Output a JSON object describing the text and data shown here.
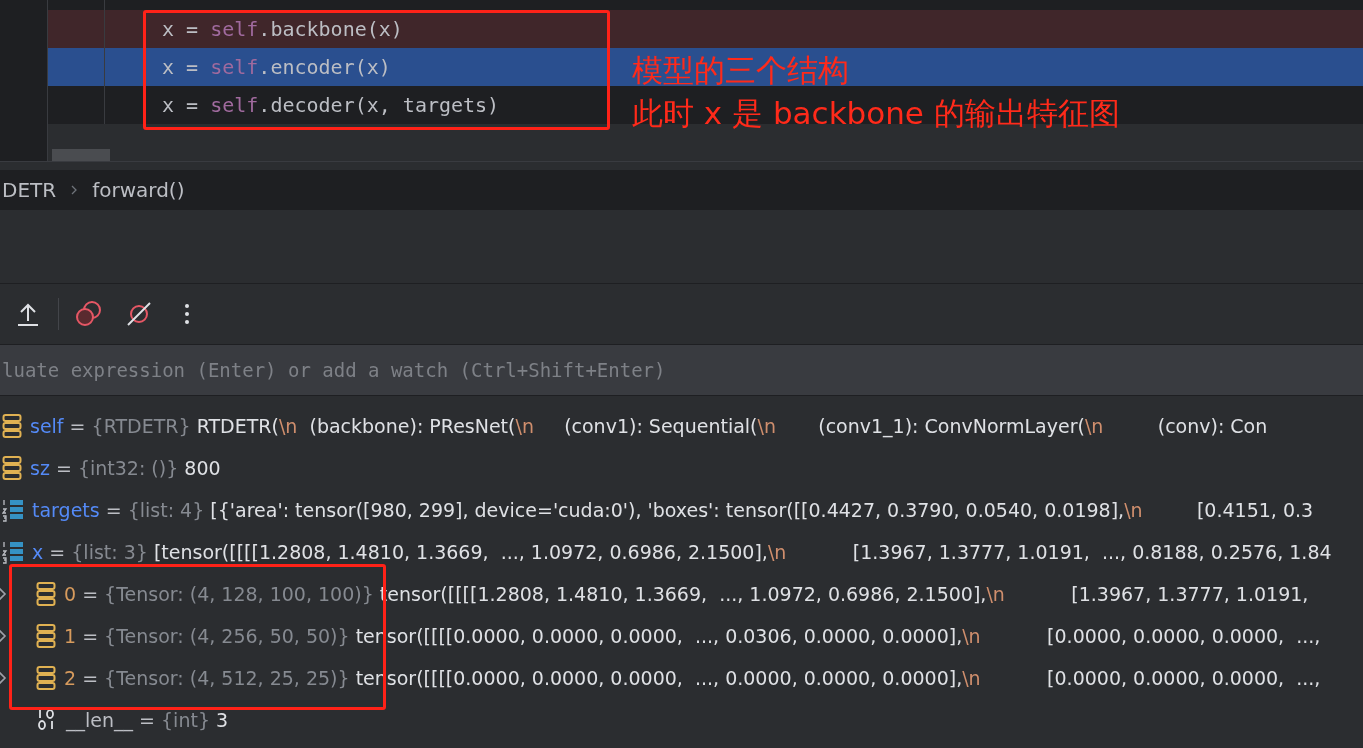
{
  "editor": {
    "lines": [
      {
        "kind": "breakpoint",
        "parts": [
          {
            "text": "x = ",
            "kind": "plain"
          },
          {
            "text": "self",
            "kind": "keyword"
          },
          {
            "text": ".backbone(x)",
            "kind": "plain"
          }
        ]
      },
      {
        "kind": "current",
        "parts": [
          {
            "text": "x = ",
            "kind": "plain"
          },
          {
            "text": "self",
            "kind": "keyword"
          },
          {
            "text": ".encoder(x)",
            "kind": "plain"
          }
        ]
      },
      {
        "kind": "plain",
        "parts": [
          {
            "text": "x = ",
            "kind": "plain"
          },
          {
            "text": "self",
            "kind": "keyword"
          },
          {
            "text": ".decoder(x, targets)",
            "kind": "plain"
          }
        ]
      }
    ],
    "annotation": [
      "模型的三个结构",
      "此时 x 是 backbone 的输出特征图"
    ]
  },
  "breadcrumb": [
    "DETR",
    "forward()"
  ],
  "eval_field": {
    "placeholder": "luate expression (Enter) or add a watch (Ctrl+Shift+Enter)"
  },
  "variables": [
    {
      "kind": "object",
      "name": "self",
      "color": "#548af7",
      "operator": "=",
      "type": "{RTDETR}",
      "value": [
        {
          "text": "RTDETR(",
          "kind": "plain"
        },
        {
          "text": "\\n",
          "kind": "escape"
        },
        {
          "text": "  (backbone): PResNet(",
          "kind": "plain"
        },
        {
          "text": "\\n",
          "kind": "escape"
        },
        {
          "text": "     (conv1): Sequential(",
          "kind": "plain"
        },
        {
          "text": "\\n",
          "kind": "escape"
        },
        {
          "text": "       (conv1_1): ConvNormLayer(",
          "kind": "plain"
        },
        {
          "text": "\\n",
          "kind": "escape"
        },
        {
          "text": "         (conv): Con",
          "kind": "plain"
        }
      ]
    },
    {
      "kind": "object",
      "name": "sz",
      "color": "#548af7",
      "operator": "=",
      "type": "{int32: ()}",
      "value": [
        {
          "text": "800",
          "kind": "plain"
        }
      ]
    },
    {
      "kind": "list",
      "name": "targets",
      "color": "#548af7",
      "operator": "=",
      "type": "{list: 4}",
      "value": [
        {
          "text": "[{'area': tensor([980, 299], device='cuda:0'), 'boxes': tensor([[0.4427, 0.3790, 0.0540, 0.0198],",
          "kind": "plain"
        },
        {
          "text": "\\n",
          "kind": "escape"
        },
        {
          "text": "         [0.4151, 0.3",
          "kind": "plain"
        }
      ]
    },
    {
      "kind": "list",
      "name": "x",
      "color": "#548af7",
      "operator": "=",
      "type": "{list: 3}",
      "value": [
        {
          "text": "[tensor([[[[1.2808, 1.4810, 1.3669,  ..., 1.0972, 0.6986, 2.1500],",
          "kind": "plain"
        },
        {
          "text": "\\n",
          "kind": "escape"
        },
        {
          "text": "           [1.3967, 1.3777, 1.0191,  ..., 0.8188, 0.2576, 1.84",
          "kind": "plain"
        }
      ],
      "children": [
        {
          "kind": "object",
          "name": "0",
          "color": "#d79b5d",
          "operator": "=",
          "expanded": false,
          "type": "{Tensor: (4, 128, 100, 100)}",
          "value": [
            {
              "text": "tensor([[[[1.2808, 1.4810, 1.3669,  ..., 1.0972, 0.6986, 2.1500],",
              "kind": "plain"
            },
            {
              "text": "\\n",
              "kind": "escape"
            },
            {
              "text": "           [1.3967, 1.3777, 1.0191,",
              "kind": "plain"
            }
          ]
        },
        {
          "kind": "object",
          "name": "1",
          "color": "#d79b5d",
          "operator": "=",
          "expanded": false,
          "type": "{Tensor: (4, 256, 50, 50)}",
          "value": [
            {
              "text": "tensor([[[[0.0000, 0.0000, 0.0000,  ..., 0.0306, 0.0000, 0.0000],",
              "kind": "plain"
            },
            {
              "text": "\\n",
              "kind": "escape"
            },
            {
              "text": "           [0.0000, 0.0000, 0.0000,  ...,",
              "kind": "plain"
            }
          ]
        },
        {
          "kind": "object",
          "name": "2",
          "color": "#d79b5d",
          "operator": "=",
          "expanded": false,
          "type": "{Tensor: (4, 512, 25, 25)}",
          "value": [
            {
              "text": "tensor([[[[0.0000, 0.0000, 0.0000,  ..., 0.0000, 0.0000, 0.0000],",
              "kind": "plain"
            },
            {
              "text": "\\n",
              "kind": "escape"
            },
            {
              "text": "           [0.0000, 0.0000, 0.0000,  ...,",
              "kind": "plain"
            }
          ]
        },
        {
          "kind": "int",
          "name": "__len__",
          "color": "#bcbec4",
          "operator": "=",
          "type": "{int}",
          "value": [
            {
              "text": "3",
              "kind": "plain"
            }
          ]
        }
      ]
    }
  ]
}
